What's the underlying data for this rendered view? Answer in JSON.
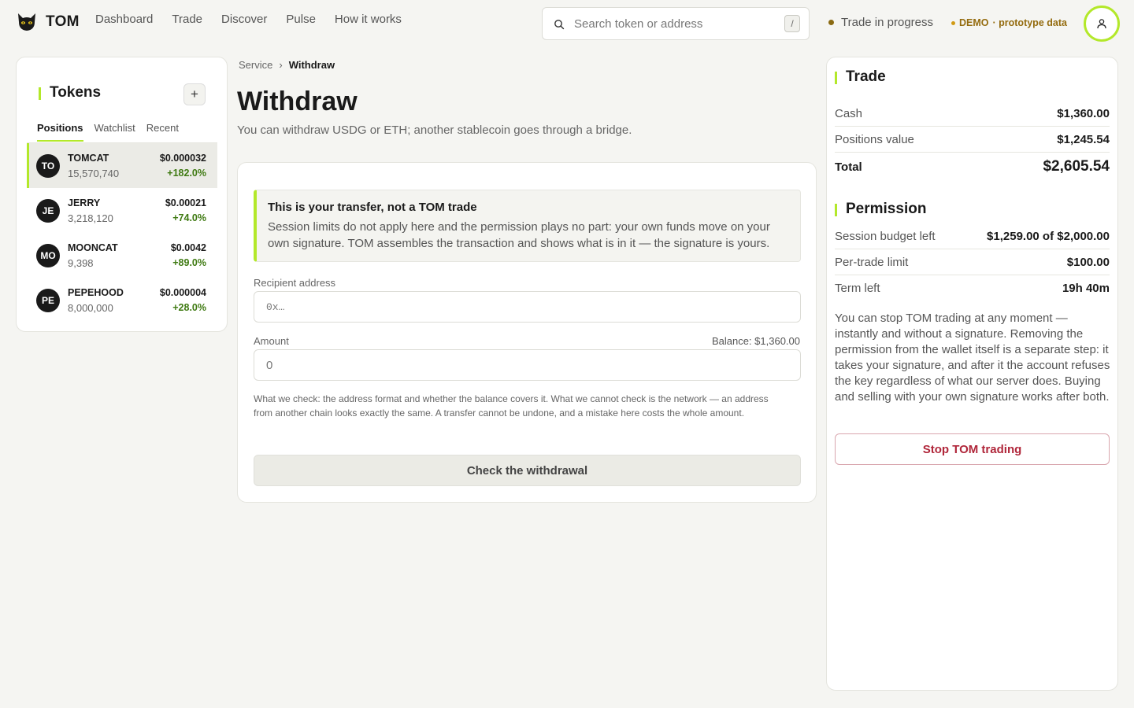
{
  "app": {
    "logo_text": "TOM"
  },
  "nav": [
    "Dashboard",
    "Trade",
    "Discover",
    "Pulse",
    "How it works"
  ],
  "search": {
    "placeholder": "Search token or address",
    "shortcut": "/"
  },
  "status": {
    "text": "Trade in progress",
    "demo_label": "DEMO",
    "demo_sub": "· prototype data"
  },
  "tokens_panel": {
    "title": "Tokens",
    "add_label": "+",
    "tabs": [
      "Positions",
      "Watchlist",
      "Recent"
    ],
    "items": [
      {
        "badge": "TO",
        "name": "TOMCAT",
        "qty": "15,570,740",
        "price": "$0.000032",
        "change": "+182.0%"
      },
      {
        "badge": "JE",
        "name": "JERRY",
        "qty": "3,218,120",
        "price": "$0.00021",
        "change": "+74.0%"
      },
      {
        "badge": "MO",
        "name": "MOONCAT",
        "qty": "9,398",
        "price": "$0.0042",
        "change": "+89.0%"
      },
      {
        "badge": "PE",
        "name": "PEPEHOOD",
        "qty": "8,000,000",
        "price": "$0.000004",
        "change": "+28.0%"
      }
    ]
  },
  "breadcrumb": {
    "parent": "Service",
    "separator": "›",
    "current": "Withdraw"
  },
  "main": {
    "title": "Withdraw",
    "subtitle": "You can withdraw USDG or ETH; another stablecoin goes through a bridge.",
    "notice_title": "This is your transfer, not a TOM trade",
    "notice_body": "Session limits do not apply here and the permission plays no part: your own funds move on your own signature. TOM assembles the transaction and shows what is in it — the signature is yours.",
    "recipient_label": "Recipient address",
    "recipient_placeholder": "0x…",
    "amount_label": "Amount",
    "amount_placeholder": "0",
    "balance": "Balance: $1,360.00",
    "note": "What we check: the address format and whether the balance covers it. What we cannot check is the network — an address from another chain looks exactly the same. A transfer cannot be undone, and a mistake here costs the whole amount.",
    "check_button": "Check the withdrawal"
  },
  "trade": {
    "title": "Trade",
    "rows": [
      {
        "label": "Cash",
        "value": "$1,360.00"
      },
      {
        "label": "Positions value",
        "value": "$1,245.54"
      }
    ],
    "total_label": "Total",
    "total_value": "$2,605.54"
  },
  "permission": {
    "title": "Permission",
    "rows": [
      {
        "label": "Session budget left",
        "value": "$1,259.00 of $2,000.00"
      },
      {
        "label": "Per-trade limit",
        "value": "$100.00"
      },
      {
        "label": "Term left",
        "value": "19h 40m"
      }
    ],
    "text": "You can stop TOM trading at any moment — instantly and without a signature. Removing the permission from the wallet itself is a separate step: it takes your signature, and after it the account refuses the key regardless of what our server does. Buying and selling with your own signature works after both.",
    "stop_button": "Stop TOM trading"
  },
  "colors": {
    "accent": "#b3e82a",
    "positive": "#3f7a12",
    "danger": "#b0263a",
    "demo": "#946b0e"
  }
}
